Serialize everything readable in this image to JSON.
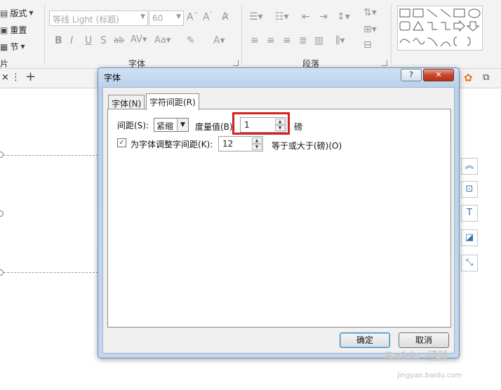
{
  "ribbon": {
    "layout_label": "版式",
    "reset_label": "重置",
    "section_label": "节",
    "slides_label": "片",
    "font_name": "等线 Light (标题)",
    "font_size": "60",
    "font_group_label": "字体",
    "paragraph_group_label": "段落"
  },
  "tabstrip": {
    "close": "×",
    "menu": "⋮",
    "add": "+"
  },
  "dialog": {
    "title": "字体",
    "help": "?",
    "close": "✕",
    "tabs": [
      {
        "label": "字体(N)"
      },
      {
        "label": "字符间距(R)"
      }
    ],
    "spacing_label": "间距(S):",
    "spacing_value": "紧缩",
    "measure_label": "度量值(B):",
    "measure_value": "1",
    "unit_label": "磅",
    "kerning_label": "为字体调整字间距(K):",
    "kerning_value": "12",
    "kerning_suffix": "等于或大于(磅)(O)",
    "ok": "确定",
    "cancel": "取消"
  },
  "watermark": {
    "text": "Baidu 经验",
    "sub": "jingyan.baidu.com"
  },
  "colors": {
    "highlight": "#d6201f",
    "accent": "#3b6fb6"
  }
}
